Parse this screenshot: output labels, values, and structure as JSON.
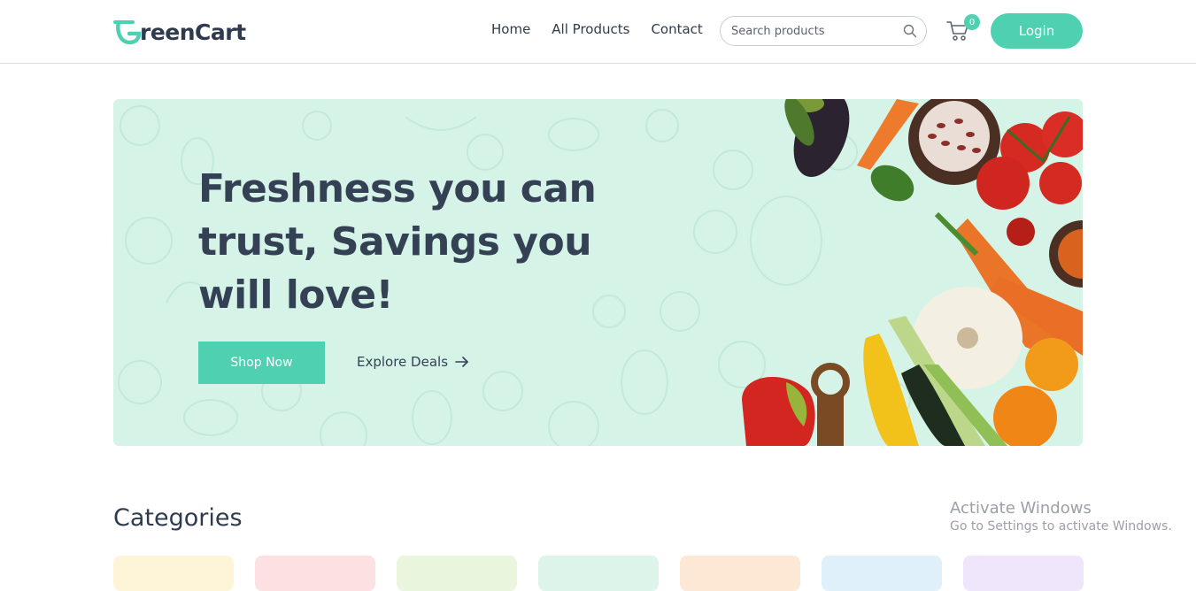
{
  "brand": {
    "name_prefix": "G",
    "name_rest": "reenCart",
    "color": "#4fd1b1"
  },
  "nav": {
    "links": [
      {
        "label": "Home"
      },
      {
        "label": "All Products"
      },
      {
        "label": "Contact"
      }
    ],
    "search_placeholder": "Search products",
    "cart_count": "0",
    "login_label": "Login"
  },
  "hero": {
    "title": "Freshness you can trust, Savings you will love!",
    "shop_button": "Shop Now",
    "explore_link": "Explore Deals",
    "background": "#d6f3e8"
  },
  "categories": {
    "title": "Categories",
    "card_colors": [
      "#fef4d8",
      "#fde0e2",
      "#eaf5dd",
      "#dcf4ea",
      "#fde8d5",
      "#dff0fb",
      "#f0e6fb"
    ]
  },
  "watermark": {
    "title": "Activate Windows",
    "subtitle": "Go to Settings to activate Windows."
  },
  "icons": [
    "search-icon",
    "cart-icon",
    "arrow-right-icon",
    "logo-mark-icon"
  ]
}
